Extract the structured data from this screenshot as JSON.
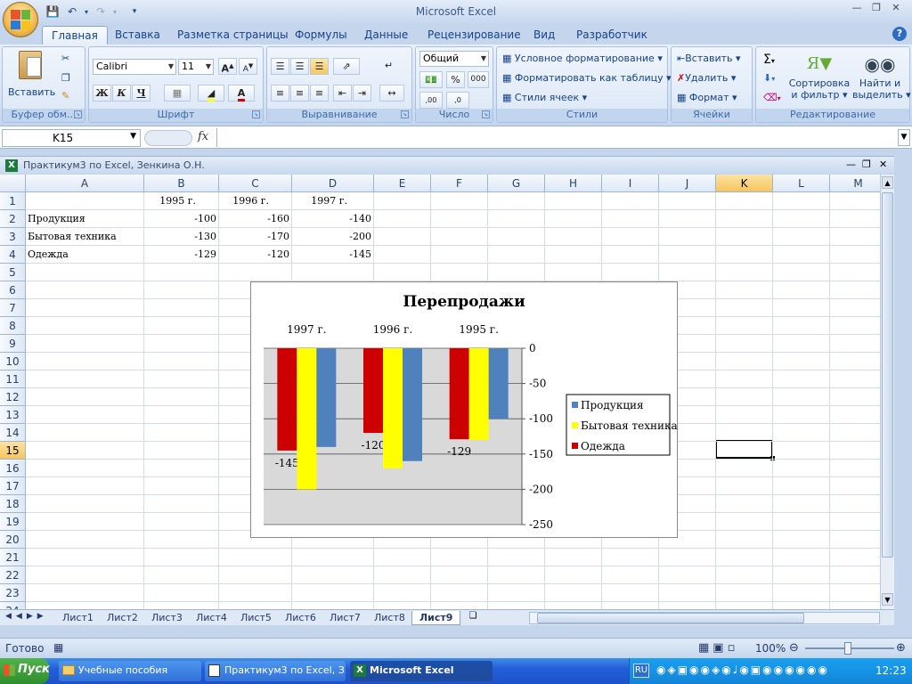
{
  "app": {
    "title": "Microsoft Excel"
  },
  "tabs": [
    "Главная",
    "Вставка",
    "Разметка страницы",
    "Формулы",
    "Данные",
    "Рецензирование",
    "Вид",
    "Разработчик"
  ],
  "ribbon": {
    "clipboard": {
      "label": "Буфер обм...",
      "paste": "Вставить"
    },
    "font": {
      "label": "Шрифт",
      "name": "Calibri",
      "size": "11",
      "bold": "Ж",
      "italic": "К",
      "underline": "Ч",
      "grow": "A",
      "shrink": "A",
      "color_letter": "A"
    },
    "alignment": {
      "label": "Выравнивание"
    },
    "number": {
      "label": "Число",
      "format": "Общий",
      "percent": "%",
      "thousands": "000",
      "inc": ",00",
      "dec": ",0"
    },
    "styles": {
      "label": "Стили",
      "cond": "Условное форматирование",
      "table": "Форматировать как таблицу",
      "cell": "Стили ячеек"
    },
    "cells": {
      "label": "Ячейки",
      "insert": "Вставить",
      "delete": "Удалить",
      "format": "Формат"
    },
    "editing": {
      "label": "Редактирование",
      "sort": "Сортировка",
      "sort2": "и фильтр",
      "find": "Найти и",
      "find2": "выделить"
    }
  },
  "formula_bar": {
    "name_box": "K15",
    "fx": "fx",
    "value": ""
  },
  "workbook": {
    "title": "Практикум3 по Excel, Зенкина О.Н.",
    "columns": [
      "A",
      "B",
      "C",
      "D",
      "E",
      "F",
      "G",
      "H",
      "I",
      "J",
      "K",
      "L",
      "M"
    ],
    "rows": [
      "1",
      "2",
      "3",
      "4",
      "5",
      "6",
      "7",
      "8",
      "9",
      "10",
      "11",
      "12",
      "13",
      "14",
      "15",
      "16",
      "17",
      "18",
      "19",
      "20",
      "21",
      "22",
      "23",
      "24"
    ],
    "cells": {
      "B1": "1995 г.",
      "C1": "1996 г.",
      "D1": "1997 г.",
      "A2": "Продукция",
      "B2": "-100",
      "C2": "-160",
      "D2": "-140",
      "A3": "Бытовая техника",
      "B3": "-130",
      "C3": "-170",
      "D3": "-200",
      "A4": "Одежда",
      "B4": "-129",
      "C4": "-120",
      "D4": "-145"
    },
    "selected": "K15"
  },
  "chart_data": {
    "type": "bar",
    "title": "Перепродажи",
    "categories": [
      "1997 г.",
      "1996 г.",
      "1995 г."
    ],
    "series": [
      {
        "name": "Одежда",
        "values": [
          -145,
          -120,
          -129
        ],
        "color": "#cc0000"
      },
      {
        "name": "Бытовая техника",
        "values": [
          -200,
          -170,
          -130
        ],
        "color": "#ffff00"
      },
      {
        "name": "Продукция",
        "values": [
          -140,
          -160,
          -100
        ],
        "color": "#4f81bd"
      }
    ],
    "legend_order": [
      "Продукция",
      "Бытовая техника",
      "Одежда"
    ],
    "data_labels": {
      "series": "Одежда",
      "values": [
        "-145",
        "-120",
        "-129"
      ]
    },
    "ylim": [
      -250,
      0
    ],
    "yticks": [
      "0",
      "-50",
      "-100",
      "-150",
      "-200",
      "-250"
    ],
    "legend": "right",
    "plot_bg": "#d9d9d9",
    "grid": true
  },
  "sheets": [
    "Лист1",
    "Лист2",
    "Лист3",
    "Лист4",
    "Лист5",
    "Лист6",
    "Лист7",
    "Лист8",
    "Лист9"
  ],
  "active_sheet": "Лист9",
  "status": {
    "ready": "Готово",
    "zoom": "100%"
  },
  "taskbar": {
    "start": "Пуск",
    "tasks": [
      "Учебные пособия",
      "Практикум3 по Excel, З...",
      "Microsoft Excel"
    ],
    "lang": "RU",
    "clock": "12:23"
  }
}
